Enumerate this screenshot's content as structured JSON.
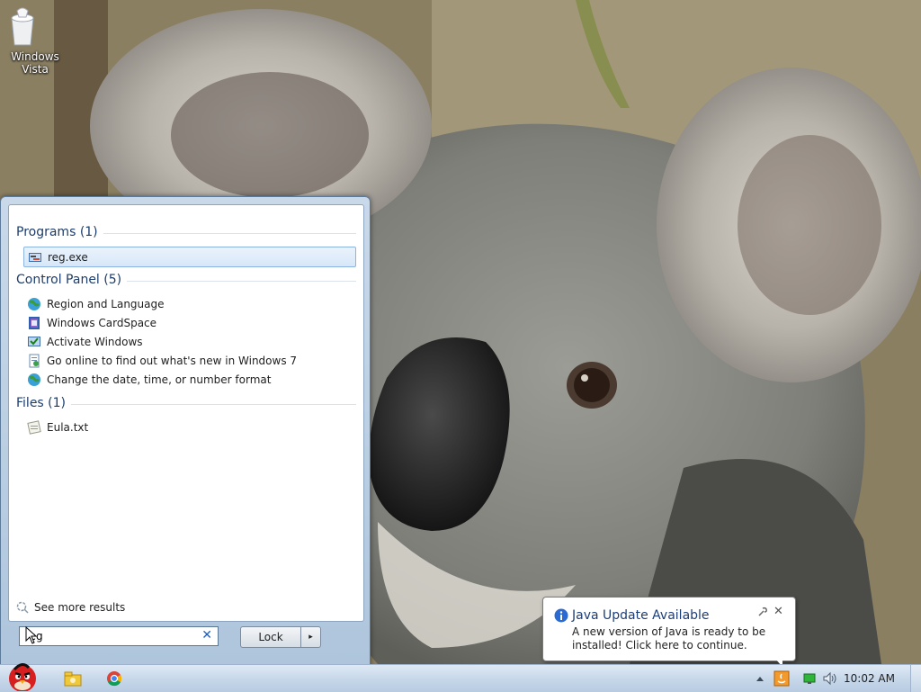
{
  "desktop": {
    "icons": [
      {
        "label_line1": "Windows",
        "label_line2": "Vista",
        "icon": "recycle-bin-icon"
      }
    ]
  },
  "start_menu": {
    "groups": {
      "programs": {
        "label": "Programs (1)",
        "items": [
          {
            "label": "reg.exe",
            "icon": "regedit-icon",
            "selected": true
          }
        ]
      },
      "control_panel": {
        "label": "Control Panel (5)",
        "items": [
          {
            "label": "Region and Language",
            "icon": "globe-icon"
          },
          {
            "label": "Windows CardSpace",
            "icon": "cardspace-icon"
          },
          {
            "label": "Activate Windows",
            "icon": "activate-icon"
          },
          {
            "label": "Go online to find out what's new in Windows 7",
            "icon": "document-icon"
          },
          {
            "label": "Change the date, time, or number format",
            "icon": "globe-icon"
          }
        ]
      },
      "files": {
        "label": "Files (1)",
        "items": [
          {
            "label": "Eula.txt",
            "icon": "text-file-icon"
          }
        ]
      }
    },
    "see_more": "See more results",
    "search": {
      "value": "reg",
      "clear_icon": "close-icon"
    },
    "power": {
      "label": "Lock",
      "arrow": "▸"
    }
  },
  "notification": {
    "title": "Java Update Available",
    "message": "A new version of Java is ready to be installed! Click here to continue.",
    "close": "✕"
  },
  "taskbar": {
    "pinned": [
      "angry-birds-start-icon",
      "explorer-icon",
      "chrome-icon"
    ],
    "tray": [
      "show-hidden-icons-arrow",
      "java-update-icon",
      "network-icon",
      "volume-icon"
    ],
    "clock": "10:02 AM"
  },
  "colors": {
    "accent": "#1d3d6b",
    "taskbar": "#c8d8ea",
    "selection": "#d7e7f8"
  }
}
